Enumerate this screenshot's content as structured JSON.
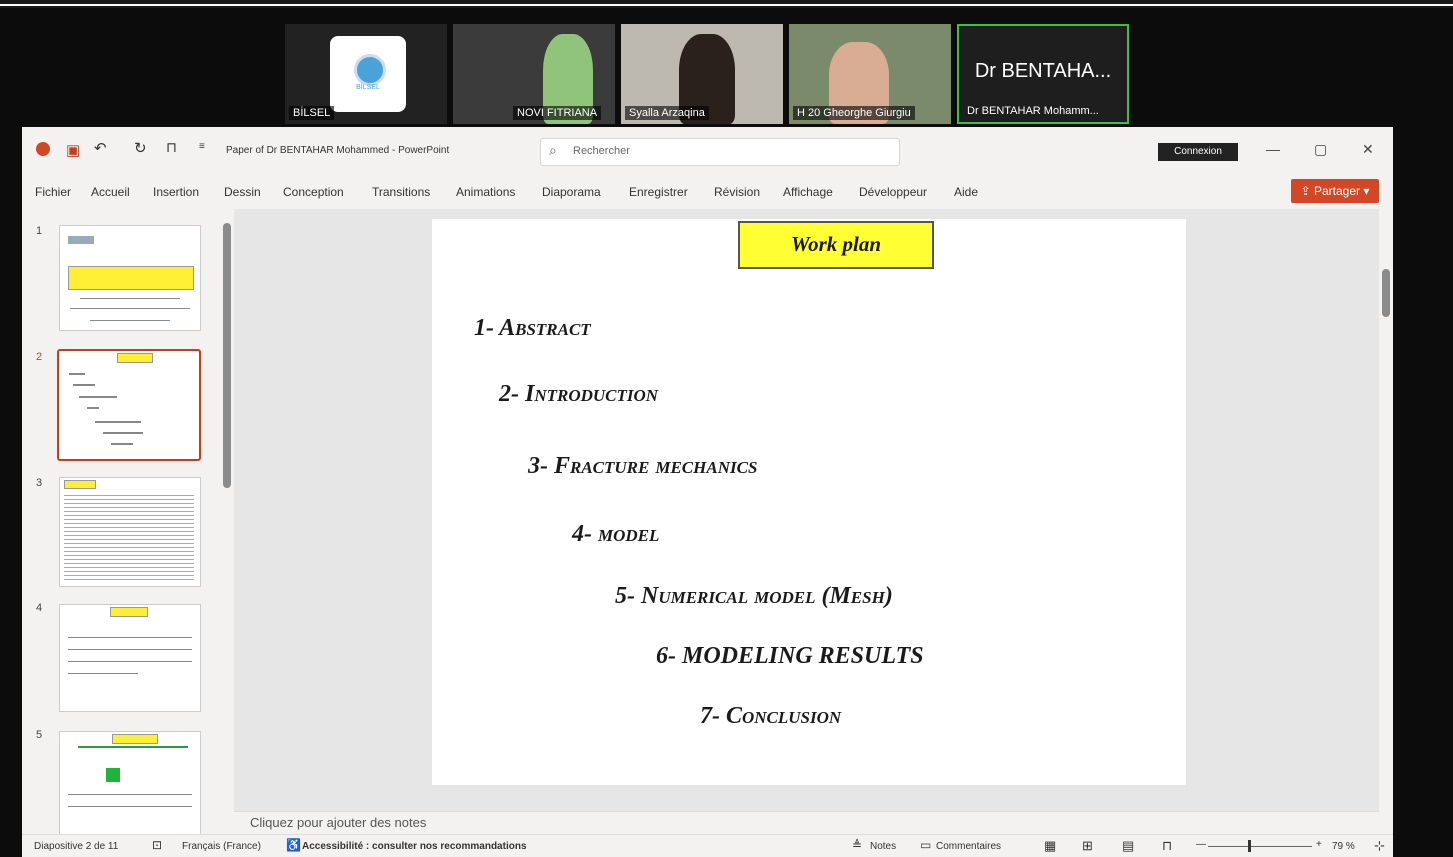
{
  "gallery": {
    "participants": [
      {
        "name": "BİLSEL",
        "logo_text": "BİLSEL"
      },
      {
        "name": "NOVI FITRIANA"
      },
      {
        "name": "Syalla Arzaqina"
      },
      {
        "name": "H 20 Gheorghe Giurgiu"
      },
      {
        "name": "Dr BENTAHAR Mohamm...",
        "display": "Dr BENTAHA..."
      }
    ]
  },
  "window": {
    "title": "Paper of Dr BENTAHAR Mohammed  -  PowerPoint",
    "search_placeholder": "Rechercher",
    "connexion": "Connexion",
    "minimize": "—",
    "restore": "▢",
    "close": "✕",
    "share": "Partager"
  },
  "ribbon": {
    "tabs": [
      "Fichier",
      "Accueil",
      "Insertion",
      "Dessin",
      "Conception",
      "Transitions",
      "Animations",
      "Diaporama",
      "Enregistrer",
      "Révision",
      "Affichage",
      "Développeur",
      "Aide"
    ]
  },
  "thumbnails": {
    "numbers": [
      "1",
      "2",
      "3",
      "4",
      "5"
    ],
    "selected": 2
  },
  "slide": {
    "title": "Work plan",
    "items": [
      "1- Abstract",
      "2- Introduction",
      "3-  Fracture mechanics",
      "4-  model",
      "5- Numerical model (Mesh)",
      "6- MODELING RESULTS",
      "7- Conclusion"
    ]
  },
  "notes": {
    "placeholder": "Cliquez pour ajouter des notes"
  },
  "status": {
    "slide_indicator": "Diapositive 2 de 11",
    "language": "Français (France)",
    "accessibility": "Accessibilité : consulter nos recommandations",
    "notes": "Notes",
    "comments": "Commentaires",
    "zoom": "79 %"
  },
  "colors": {
    "accent": "#c43e1c",
    "share_bg": "#d24726",
    "callout_fill": "#ffff33",
    "speaker_border": "#3fbf4a"
  }
}
